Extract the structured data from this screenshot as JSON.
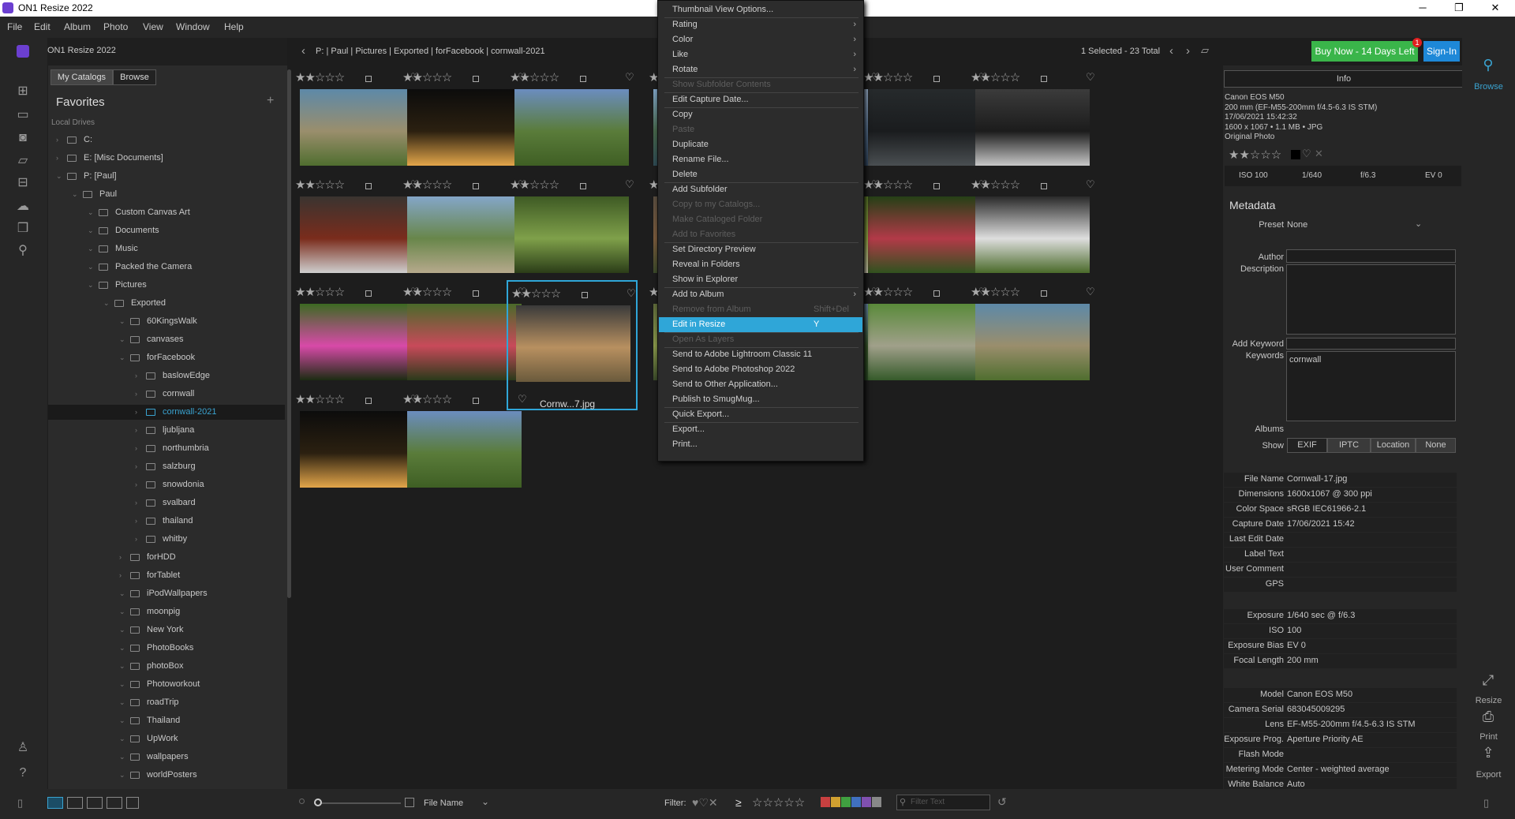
{
  "window": {
    "title": "ON1 Resize 2022",
    "min": "─",
    "max": "❐",
    "close": "✕"
  },
  "menu": [
    "File",
    "Edit",
    "Album",
    "Photo",
    "View",
    "Window",
    "Help"
  ],
  "product": "ON1 Resize 2022",
  "side_tabs": {
    "catalogs": "My Catalogs",
    "browse": "Browse"
  },
  "favorites": {
    "title": "Favorites",
    "add": "+",
    "local_drives": "Local Drives"
  },
  "tree": [
    {
      "label": "C:",
      "depth": 0
    },
    {
      "label": "E: [Misc Documents]",
      "depth": 0
    },
    {
      "label": "P: [Paul]",
      "depth": 0
    },
    {
      "label": "Paul",
      "depth": 1
    },
    {
      "label": "Custom Canvas Art",
      "depth": 2
    },
    {
      "label": "Documents",
      "depth": 2
    },
    {
      "label": "Music",
      "depth": 2
    },
    {
      "label": "Packed the Camera",
      "depth": 2
    },
    {
      "label": "Pictures",
      "depth": 2
    },
    {
      "label": "Exported",
      "depth": 3
    },
    {
      "label": "60KingsWalk",
      "depth": 4
    },
    {
      "label": "canvases",
      "depth": 4
    },
    {
      "label": "forFacebook",
      "depth": 4
    },
    {
      "label": "baslowEdge",
      "depth": 5
    },
    {
      "label": "cornwall",
      "depth": 5
    },
    {
      "label": "cornwall-2021",
      "depth": 5
    },
    {
      "label": "ljubljana",
      "depth": 5
    },
    {
      "label": "northumbria",
      "depth": 5
    },
    {
      "label": "salzburg",
      "depth": 5
    },
    {
      "label": "snowdonia",
      "depth": 5
    },
    {
      "label": "svalbard",
      "depth": 5
    },
    {
      "label": "thailand",
      "depth": 5
    },
    {
      "label": "whitby",
      "depth": 5
    },
    {
      "label": "forHDD",
      "depth": 4
    },
    {
      "label": "forTablet",
      "depth": 4
    },
    {
      "label": "iPodWallpapers",
      "depth": 4
    },
    {
      "label": "moonpig",
      "depth": 4
    },
    {
      "label": "New York",
      "depth": 4
    },
    {
      "label": "PhotoBooks",
      "depth": 4
    },
    {
      "label": "photoBox",
      "depth": 4
    },
    {
      "label": "Photoworkout",
      "depth": 4
    },
    {
      "label": "roadTrip",
      "depth": 4
    },
    {
      "label": "Thailand",
      "depth": 4
    },
    {
      "label": "UpWork",
      "depth": 4
    },
    {
      "label": "wallpapers",
      "depth": 4
    },
    {
      "label": "worldPosters",
      "depth": 4
    }
  ],
  "breadcrumb": "P: | Paul | Pictures | Exported | forFacebook | cornwall-2021",
  "selection": "1 Selected - 23 Total",
  "buy": "Buy Now - 14 Days Left",
  "badge": "1",
  "signin": "Sign-In",
  "stars": "★★☆☆☆",
  "grid_checkbox": "□",
  "heart": "♡",
  "selected_file": "Cornw...7.jpg",
  "context_menu": [
    {
      "label": "Thumbnail View Options...",
      "state": "normal"
    },
    {
      "label": "Rating",
      "state": "normal",
      "sub": "›"
    },
    {
      "label": "Color",
      "state": "normal",
      "sub": "›"
    },
    {
      "label": "Like",
      "state": "normal",
      "sub": "›"
    },
    {
      "label": "Rotate",
      "state": "normal",
      "sub": "›"
    },
    {
      "label": "Show Subfolder Contents",
      "state": "disabled"
    },
    {
      "label": "Edit Capture Date...",
      "state": "normal"
    },
    {
      "label": "Copy",
      "state": "normal"
    },
    {
      "label": "Paste",
      "state": "disabled"
    },
    {
      "label": "Duplicate",
      "state": "normal"
    },
    {
      "label": "Rename File...",
      "state": "normal"
    },
    {
      "label": "Delete",
      "state": "normal"
    },
    {
      "label": "Add Subfolder",
      "state": "normal"
    },
    {
      "label": "Copy to my Catalogs...",
      "state": "disabled"
    },
    {
      "label": "Make Cataloged Folder",
      "state": "disabled"
    },
    {
      "label": "Add to Favorites",
      "state": "disabled"
    },
    {
      "label": "Set Directory Preview",
      "state": "normal"
    },
    {
      "label": "Reveal in Folders",
      "state": "normal"
    },
    {
      "label": "Show in Explorer",
      "state": "normal"
    },
    {
      "label": "Add to Album",
      "state": "normal",
      "sub": "›"
    },
    {
      "label": "Remove from Album",
      "state": "disabled",
      "shortcut": "Shift+Del"
    },
    {
      "label": "Edit in Resize",
      "state": "highlight",
      "shortcut": "Y"
    },
    {
      "label": "Open As Layers",
      "state": "disabled"
    },
    {
      "label": "Send to Adobe Lightroom Classic 11",
      "state": "normal"
    },
    {
      "label": "Send to Adobe Photoshop 2022",
      "state": "normal"
    },
    {
      "label": "Send to Other Application...",
      "state": "normal"
    },
    {
      "label": "Publish to SmugMug...",
      "state": "normal"
    },
    {
      "label": "Quick Export...",
      "state": "normal"
    },
    {
      "label": "Export...",
      "state": "normal"
    },
    {
      "label": "Print...",
      "state": "normal"
    }
  ],
  "info": {
    "tab": "Info",
    "camera": "Canon EOS M50",
    "lens_line": "200 mm (EF-M55-200mm f/4.5-6.3 IS STM)",
    "date": "17/06/2021 15:42:32",
    "size": "1600 x 1067 • 1.1 MB • JPG",
    "original": "Original Photo",
    "iso": "ISO 100",
    "shutter": "1/640",
    "aperture": "f/6.3",
    "ev": "EV 0"
  },
  "metadata": {
    "title": "Metadata",
    "preset_label": "Preset",
    "preset_val": "None",
    "author": "Author",
    "description": "Description",
    "add_keyword": "Add Keyword",
    "keywords": "Keywords",
    "keywords_val": "cornwall",
    "albums": "Albums",
    "show": "Show",
    "show_tabs": [
      "EXIF",
      "IPTC",
      "Location",
      "None"
    ],
    "file_rows": [
      [
        "File Name",
        "Cornwall-17.jpg"
      ],
      [
        "Dimensions",
        "1600x1067 @ 300 ppi"
      ],
      [
        "Color Space",
        "sRGB IEC61966-2.1"
      ],
      [
        "Capture Date",
        "17/06/2021 15:42"
      ],
      [
        "Last Edit Date",
        ""
      ],
      [
        "Label Text",
        ""
      ],
      [
        "User Comment",
        ""
      ],
      [
        "GPS",
        ""
      ]
    ],
    "exp_rows": [
      [
        "Exposure",
        "1/640 sec @ f/6.3"
      ],
      [
        "ISO",
        "100"
      ],
      [
        "Exposure Bias",
        "EV 0"
      ],
      [
        "Focal Length",
        "200 mm"
      ]
    ],
    "cam_rows": [
      [
        "Model",
        "Canon EOS M50"
      ],
      [
        "Camera Serial",
        "683045009295"
      ],
      [
        "Lens",
        "EF-M55-200mm f/4.5-6.3 IS STM"
      ],
      [
        "Exposure Prog.",
        "Aperture Priority AE"
      ],
      [
        "Flash Mode",
        ""
      ],
      [
        "Metering Mode",
        "Center - weighted average"
      ],
      [
        "White Balance",
        "Auto"
      ]
    ]
  },
  "right_tools": {
    "browse": "Browse",
    "resize": "Resize",
    "print": "Print",
    "export": "Export"
  },
  "bottom": {
    "sort": "File Name",
    "filter": "Filter:",
    "filter_ph": "Filter Text",
    "filter_stars": "☆☆☆☆☆"
  },
  "colors": {
    "accent": "#2fa6d8",
    "buy": "#3ab54a",
    "signin": "#1e88d8"
  }
}
